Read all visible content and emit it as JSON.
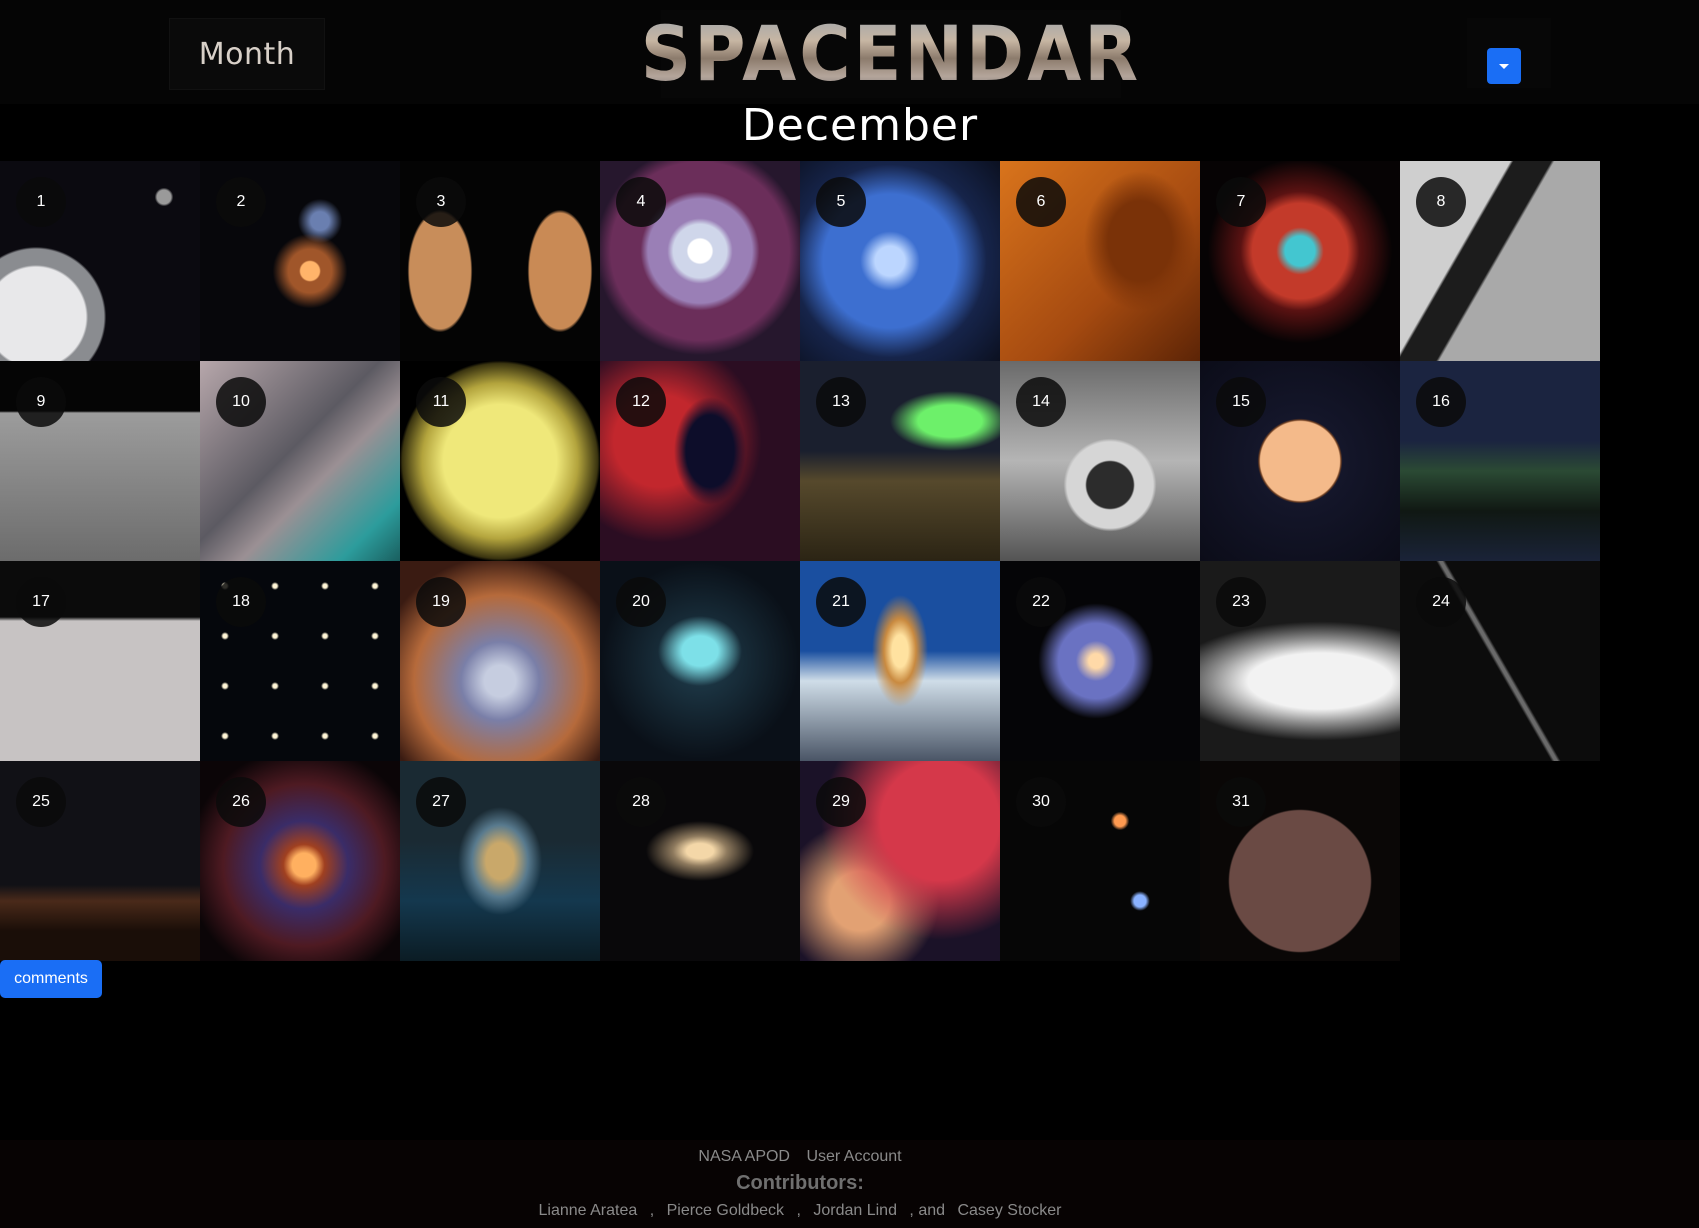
{
  "header": {
    "month_button": "Month",
    "logo": "SPACENDAR",
    "month_title": "December"
  },
  "days": [
    {
      "n": "1",
      "bg": "orion-capsule"
    },
    {
      "n": "2",
      "bg": "interacting-galaxies"
    },
    {
      "n": "3",
      "bg": "mars-pair"
    },
    {
      "n": "4",
      "bg": "nebula-tunnel"
    },
    {
      "n": "5",
      "bg": "pleiades"
    },
    {
      "n": "6",
      "bg": "eagle-pillar"
    },
    {
      "n": "7",
      "bg": "helix-nebula"
    },
    {
      "n": "8",
      "bg": "lunar-surface-orion"
    },
    {
      "n": "9",
      "bg": "lunar-horizon"
    },
    {
      "n": "10",
      "bg": "anaglyph-crater"
    },
    {
      "n": "11",
      "bg": "io-moon"
    },
    {
      "n": "12",
      "bg": "elephant-trunk"
    },
    {
      "n": "13",
      "bg": "aurora-landscape"
    },
    {
      "n": "14",
      "bg": "lunar-rover-wheel"
    },
    {
      "n": "15",
      "bg": "full-moon"
    },
    {
      "n": "16",
      "bg": "lake-night-sky"
    },
    {
      "n": "17",
      "bg": "lunar-rover-anaglyph"
    },
    {
      "n": "18",
      "bg": "star-grid"
    },
    {
      "n": "19",
      "bg": "dusty-nebula"
    },
    {
      "n": "20",
      "bg": "thors-helmet"
    },
    {
      "n": "21",
      "bg": "solar-halo-ice"
    },
    {
      "n": "22",
      "bg": "barred-spiral"
    },
    {
      "n": "23",
      "bg": "saturn-rings"
    },
    {
      "n": "24",
      "bg": "meteor-streak"
    },
    {
      "n": "25",
      "bg": "monument-valley"
    },
    {
      "n": "26",
      "bg": "shell-nebula"
    },
    {
      "n": "27",
      "bg": "mountain-halo"
    },
    {
      "n": "28",
      "bg": "spiral-galaxy"
    },
    {
      "n": "29",
      "bg": "horsehead-flame"
    },
    {
      "n": "30",
      "bg": "star-field-orange"
    },
    {
      "n": "31",
      "bg": "planet-silhouette"
    }
  ],
  "comments_button": "comments",
  "footer": {
    "links": [
      "NASA APOD",
      "User Account"
    ],
    "contributors_title": "Contributors:",
    "contributors": [
      "Lianne Aratea",
      ",",
      "Pierce Goldbeck",
      ",",
      "Jordan Lind",
      ", and",
      "Casey Stocker"
    ]
  },
  "colors": {
    "accent": "#1a6ef5",
    "background": "#000000"
  }
}
